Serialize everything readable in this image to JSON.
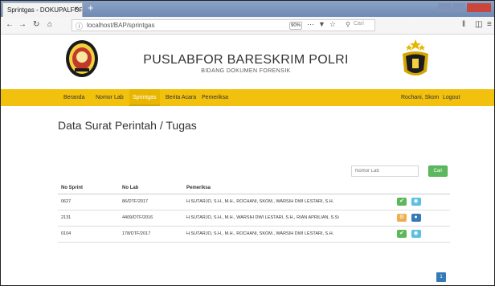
{
  "browser": {
    "tab_title": "Sprintgas - DOKUPALFOR",
    "tab_close": "×",
    "new_tab": "+",
    "url": "localhost/BAP/sprintgas",
    "zoom": "90%",
    "search_placeholder": "Cari",
    "icons": [
      "back-icon",
      "forward-icon",
      "reload-icon",
      "home-icon",
      "info-icon",
      "more-icon",
      "pocket-icon",
      "bookmark-icon",
      "search-icon",
      "library-icon",
      "sidebar-icon",
      "menu-icon"
    ]
  },
  "header": {
    "title": "PUSLABFOR BARESKRIM POLRI",
    "subtitle": "BIDANG DOKUMEN FORENSIK",
    "logo_left_text": "PUSLABFOR",
    "logo_right_text": "POLRI"
  },
  "nav": {
    "items": [
      "Beranda",
      "Nomor Lab",
      "Sprintgas",
      "Berita Acara",
      "Pemeriksa"
    ],
    "active": "Sprintgas",
    "user": "Rochani, Skom",
    "logout": "Logout"
  },
  "colors": {
    "nav_bg": "#f2c10d",
    "btn_green": "#5cb85c",
    "btn_blue": "#5bc0de",
    "btn_orange": "#f0ad4e",
    "btn_navy": "#337ab7"
  },
  "main": {
    "title": "Data Surat Perintah / Tugas",
    "search_placeholder": "Nomor Lab",
    "search_button": "Cari",
    "columns": [
      "No Sprint",
      "No Lab",
      "Pemeriksa"
    ],
    "rows": [
      {
        "sprint": "0627",
        "lab": "86/DTF/2017",
        "pemeriksa": "H.SUTARJO, S.H., M.H., ROCHANI, SKOM., WARSIH DWI LESTARI, S.H.",
        "actions": [
          "check",
          "eye"
        ]
      },
      {
        "sprint": "2131",
        "lab": "4409/DTF/2016",
        "pemeriksa": "H.SUTARJO, S.H., M.H., WARSIH DWI LESTARI, S.H., RIAN APRILIAN, S.Si",
        "actions": [
          "gear",
          "user"
        ]
      },
      {
        "sprint": "0104",
        "lab": "178/DTF/2017",
        "pemeriksa": "H.SUTARJO, S.H., M.H., ROCHANI, SKOM., WARSIH DWI LESTARI, S.H.",
        "actions": [
          "check",
          "eye"
        ]
      }
    ],
    "page": "1"
  }
}
